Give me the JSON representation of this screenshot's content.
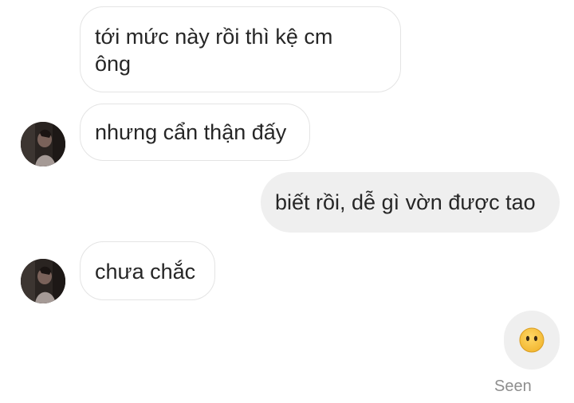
{
  "messages": [
    {
      "direction": "incoming",
      "text": "tới mức này rồi thì kệ cm\nông"
    },
    {
      "direction": "incoming",
      "text": "nhưng cẩn thận đấy"
    },
    {
      "direction": "outgoing",
      "text": "biết rồi, dễ gì vờn được tao"
    },
    {
      "direction": "incoming",
      "text": "chưa chắc"
    },
    {
      "direction": "outgoing",
      "emoji": "face-without-mouth-emoji-icon"
    }
  ],
  "status": {
    "seen_label": "Seen"
  },
  "colors": {
    "incoming_bubble_bg": "#ffffff",
    "incoming_bubble_border": "#e4e4e4",
    "outgoing_bubble_bg": "#efefef",
    "text": "#262626",
    "seen_text": "#8e8e8e",
    "emoji_yellow": "#f6c33c"
  }
}
